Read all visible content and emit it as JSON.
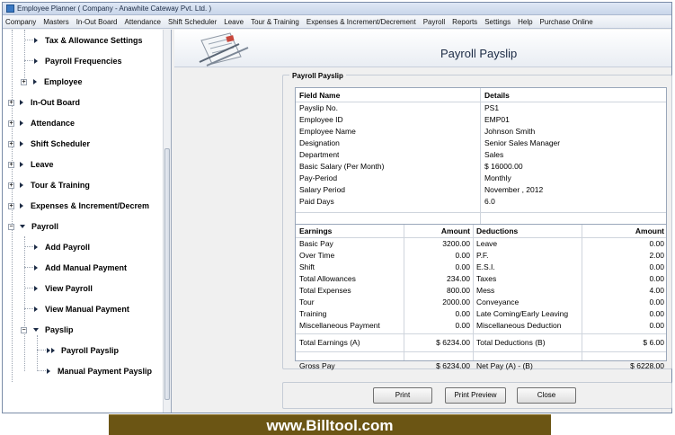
{
  "window": {
    "title": "Employee Planner ( Company - Anawhite Cateway Pvt. Ltd. )"
  },
  "menu": [
    "Company",
    "Masters",
    "In-Out Board",
    "Attendance",
    "Shift Scheduler",
    "Leave",
    "Tour & Training",
    "Expenses & Increment/Decrement",
    "Payroll",
    "Reports",
    "Settings",
    "Help",
    "Purchase Online"
  ],
  "sidebar": {
    "items": [
      {
        "label": "Tax & Allowance Settings"
      },
      {
        "label": "Payroll Frequencies"
      },
      {
        "label": "Employee"
      },
      {
        "label": "In-Out Board"
      },
      {
        "label": "Attendance"
      },
      {
        "label": "Shift Scheduler"
      },
      {
        "label": "Leave"
      },
      {
        "label": "Tour & Training"
      },
      {
        "label": "Expenses & Increment/Decrem"
      },
      {
        "label": "Payroll"
      },
      {
        "label": "Add Payroll"
      },
      {
        "label": "Add Manual Payment"
      },
      {
        "label": "View Payroll"
      },
      {
        "label": "View Manual Payment"
      },
      {
        "label": "Payslip"
      },
      {
        "label": "Payroll Payslip"
      },
      {
        "label": "Manual Payment Payslip"
      }
    ]
  },
  "main": {
    "page_title": "Payroll Payslip",
    "group_title": "Payroll Payslip",
    "details_headers": {
      "field": "Field Name",
      "details": "Details"
    },
    "details": [
      {
        "field": "Payslip No.",
        "value": "PS1"
      },
      {
        "field": "Employee ID",
        "value": "EMP01"
      },
      {
        "field": "Employee Name",
        "value": "Johnson Smith"
      },
      {
        "field": "Designation",
        "value": "Senior Sales Manager"
      },
      {
        "field": "Department",
        "value": "Sales"
      },
      {
        "field": "Basic Salary (Per Month)",
        "value": "$ 16000.00"
      },
      {
        "field": "Pay-Period",
        "value": "Monthly"
      },
      {
        "field": "Salary Period",
        "value": "November , 2012"
      },
      {
        "field": "Paid Days",
        "value": "6.0"
      }
    ],
    "earn_headers": {
      "earnings": "Earnings",
      "amount": "Amount",
      "deductions": "Deductions",
      "amount2": "Amount"
    },
    "earnings": [
      {
        "name": "Basic Pay",
        "amount": "3200.00",
        "ded": "Leave",
        "ded_amount": "0.00"
      },
      {
        "name": "Over Time",
        "amount": "0.00",
        "ded": "P.F.",
        "ded_amount": "2.00"
      },
      {
        "name": "Shift",
        "amount": "0.00",
        "ded": "E.S.I.",
        "ded_amount": "0.00"
      },
      {
        "name": "Total Allowances",
        "amount": "234.00",
        "ded": "Taxes",
        "ded_amount": "0.00"
      },
      {
        "name": "Total Expenses",
        "amount": "800.00",
        "ded": "Mess",
        "ded_amount": "4.00"
      },
      {
        "name": "Tour",
        "amount": "2000.00",
        "ded": "Conveyance",
        "ded_amount": "0.00"
      },
      {
        "name": "Training",
        "amount": "0.00",
        "ded": "Late Coming/Early Leaving",
        "ded_amount": "0.00"
      },
      {
        "name": "Miscellaneous Payment",
        "amount": "0.00",
        "ded": "Miscellaneous Deduction",
        "ded_amount": "0.00"
      }
    ],
    "totals": {
      "earn_label": "Total Earnings (A)",
      "earn_value": "$ 6234.00",
      "ded_label": "Total Deductions (B)",
      "ded_value": "$ 6.00"
    },
    "gross": {
      "label": "Gross Pay",
      "value": "$ 6234.00",
      "net_label": "Net Pay (A) - (B)",
      "net_value": "$ 6228.00"
    },
    "buttons": {
      "print": "Print",
      "preview": "Print Preview",
      "close": "Close"
    }
  },
  "banner": "www.Billtool.com"
}
